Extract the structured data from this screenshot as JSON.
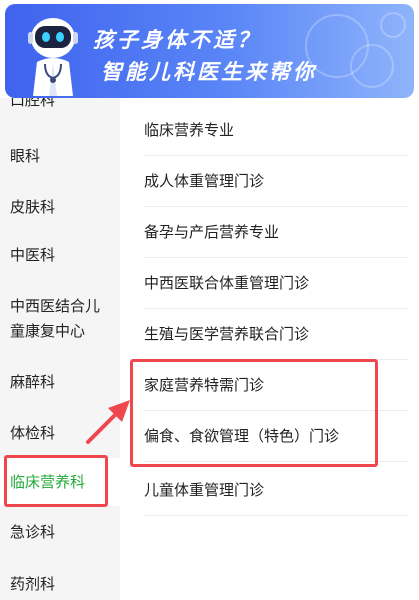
{
  "banner": {
    "line1": "孩子身体不适？",
    "line2": "智能儿科医生来帮你"
  },
  "sidebar": {
    "items": [
      {
        "label": "口腔科"
      },
      {
        "label": "眼科"
      },
      {
        "label": "皮肤科"
      },
      {
        "label": "中医科"
      },
      {
        "label": "中西医结合儿",
        "label2": "童康复中心"
      },
      {
        "label": "麻醉科"
      },
      {
        "label": "体检科"
      },
      {
        "label": "临床营养科",
        "active": true
      },
      {
        "label": "急诊科"
      },
      {
        "label": "药剂科"
      }
    ]
  },
  "clinics": {
    "items": [
      {
        "label": "临床营养专业"
      },
      {
        "label": "成人体重管理门诊"
      },
      {
        "label": "备孕与产后营养专业"
      },
      {
        "label": "中西医联合体重管理门诊"
      },
      {
        "label": "生殖与医学营养联合门诊"
      },
      {
        "label": "家庭营养特需门诊"
      },
      {
        "label": "偏食、食欲管理（特色）门诊"
      },
      {
        "label": "儿童体重管理门诊"
      }
    ]
  },
  "colors": {
    "accent_green": "#22ab38",
    "highlight_red": "#f0474e",
    "banner_blue": "#3f63ee"
  }
}
